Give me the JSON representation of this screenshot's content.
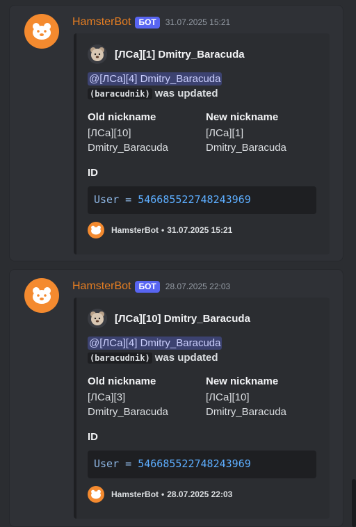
{
  "messages": [
    {
      "username": "HamsterBot",
      "badge": "БОТ",
      "timestamp": "31.07.2025 15:21",
      "embed": {
        "author": "[ЛСа][1] Dmitry_Baracuda",
        "mention": "@[ЛСа][4] Dmitry_Baracuda",
        "code": "(baracudnik)",
        "desc_tail": "was updated",
        "old_label": "Old nickname",
        "old_line1": "[ЛСа][10]",
        "old_line2": "Dmitry_Baracuda",
        "new_label": "New nickname",
        "new_line1": "[ЛСа][1]",
        "new_line2": "Dmitry_Baracuda",
        "id_label": "ID",
        "code_key": "User",
        "code_eq": "=",
        "code_value": "546685522748243969",
        "footer_name": "HamsterBot",
        "footer_sep": "•",
        "footer_time": "31.07.2025 15:21"
      }
    },
    {
      "username": "HamsterBot",
      "badge": "БОТ",
      "timestamp": "28.07.2025 22:03",
      "embed": {
        "author": "[ЛСа][10] Dmitry_Baracuda",
        "mention": "@[ЛСа][4] Dmitry_Baracuda",
        "code": "(baracudnik)",
        "desc_tail": "was updated",
        "old_label": "Old nickname",
        "old_line1": "[ЛСа][3]",
        "old_line2": "Dmitry_Baracuda",
        "new_label": "New nickname",
        "new_line1": "[ЛСа][10]",
        "new_line2": "Dmitry_Baracuda",
        "id_label": "ID",
        "code_key": "User",
        "code_eq": "=",
        "code_value": "546685522748243969",
        "footer_name": "HamsterBot",
        "footer_sep": "•",
        "footer_time": "28.07.2025 22:03"
      }
    }
  ],
  "icons": {
    "bot_avatar": "hamster-icon",
    "author_avatar": "bear-avatar-icon"
  },
  "colors": {
    "username": "#e67e22",
    "badge": "#5865f2",
    "mention_bg": "#3c4270",
    "code_value": "#5daeff"
  }
}
